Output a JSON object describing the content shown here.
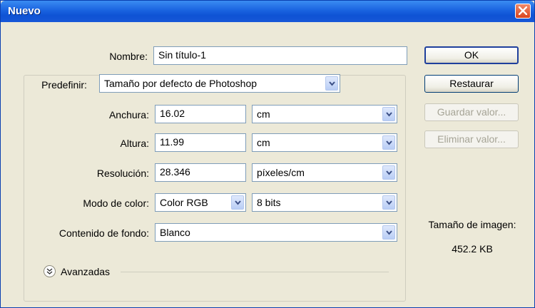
{
  "window": {
    "title": "Nuevo"
  },
  "nombre": {
    "label": "Nombre:",
    "value": "Sin título-1"
  },
  "predefinir": {
    "label": "Predefinir:",
    "value": "Tamaño por defecto de Photoshop"
  },
  "anchura": {
    "label": "Anchura:",
    "value": "16.02",
    "unit": "cm"
  },
  "altura": {
    "label": "Altura:",
    "value": "11.99",
    "unit": "cm"
  },
  "resolucion": {
    "label": "Resolución:",
    "value": "28.346",
    "unit": "píxeles/cm"
  },
  "modo_color": {
    "label": "Modo de color:",
    "value": "Color RGB",
    "bits": "8 bits"
  },
  "contenido_fondo": {
    "label": "Contenido de fondo:",
    "value": "Blanco"
  },
  "avanzadas": {
    "label": "Avanzadas"
  },
  "buttons": {
    "ok": "OK",
    "restaurar": "Restaurar",
    "guardar": "Guardar valor...",
    "eliminar": "Eliminar valor..."
  },
  "image_size": {
    "label": "Tamaño de imagen:",
    "value": "452.2 KB"
  },
  "icons": {
    "close": "close-icon",
    "dropdown": "chevron-down-icon",
    "expand": "double-chevron-down-icon"
  }
}
